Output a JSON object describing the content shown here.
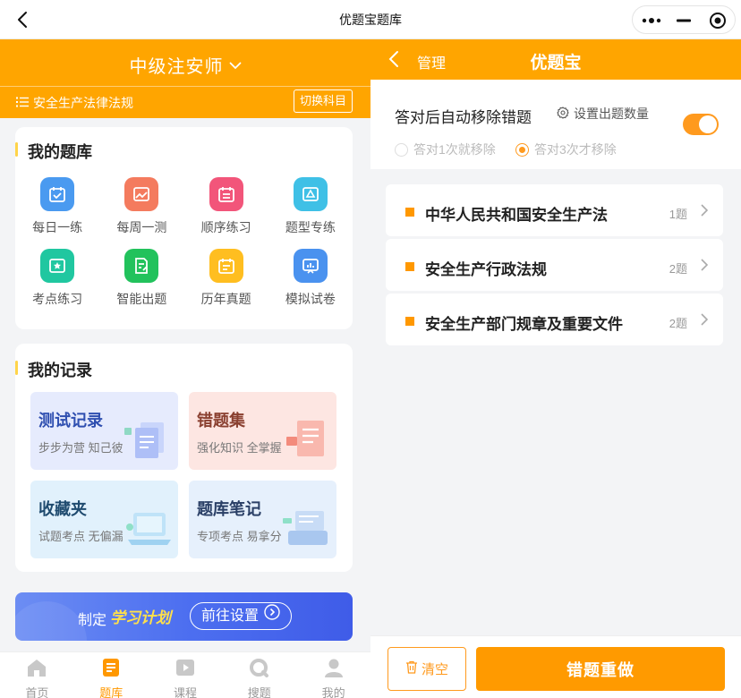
{
  "app": {
    "window_title": "优题宝题库"
  },
  "left": {
    "exam_name": "中级注安师",
    "subject": "安全生产法律法规",
    "switch_label": "切换科目",
    "library": {
      "title": "我的题库",
      "tiles": [
        {
          "label": "每日一练",
          "icon": "calendar-check-icon",
          "color": "#4a9af0"
        },
        {
          "label": "每周一测",
          "icon": "image-chart-icon",
          "color": "#f47b5e"
        },
        {
          "label": "顺序练习",
          "icon": "list-calendar-icon",
          "color": "#f2557a"
        },
        {
          "label": "题型专练",
          "icon": "triangle-board-icon",
          "color": "#3fc0e6"
        },
        {
          "label": "考点练习",
          "icon": "star-badge-icon",
          "color": "#20c7a0"
        },
        {
          "label": "智能出题",
          "icon": "doc-edit-icon",
          "color": "#22c25c"
        },
        {
          "label": "历年真题",
          "icon": "history-calendar-icon",
          "color": "#ffbe20"
        },
        {
          "label": "模拟试卷",
          "icon": "chart-board-icon",
          "color": "#4a92ef"
        }
      ]
    },
    "records": {
      "title": "我的记录",
      "items": [
        {
          "title": "测试记录",
          "subtitle": "步步为营 知己彼",
          "bg": "#e6ebfd",
          "color": "#2f4fb0"
        },
        {
          "title": "错题集",
          "subtitle": "强化知识 全掌握",
          "bg": "#fde6e2",
          "color": "#8a4030"
        },
        {
          "title": "收藏夹",
          "subtitle": "试题考点 无偏漏",
          "bg": "#e1f1fc",
          "color": "#1f4b6f"
        },
        {
          "title": "题库笔记",
          "subtitle": "专项考点 易拿分",
          "bg": "#e6f0fc",
          "color": "#2a3f66"
        }
      ]
    },
    "plan": {
      "prefix": "制定",
      "highlight": "学习计划",
      "button": "前往设置"
    },
    "tabs": [
      {
        "label": "首页",
        "icon": "home-icon"
      },
      {
        "label": "题库",
        "icon": "question-bank-icon"
      },
      {
        "label": "课程",
        "icon": "video-course-icon"
      },
      {
        "label": "搜题",
        "icon": "search-question-icon"
      },
      {
        "label": "我的",
        "icon": "user-icon"
      }
    ],
    "active_tab": 1
  },
  "right": {
    "back_label": "管理",
    "title": "优题宝",
    "auto_remove_label": "答对后自动移除错题",
    "auto_remove_on": true,
    "set_count_label": "设置出题数量",
    "remove_options": [
      {
        "label": "答对1次就移除",
        "selected": false
      },
      {
        "label": "答对3次才移除",
        "selected": true
      }
    ],
    "chapters": [
      {
        "name": "中华人民共和国安全生产法",
        "count": "1题"
      },
      {
        "name": "安全生产行政法规",
        "count": "2题"
      },
      {
        "name": "安全生产部门规章及重要文件",
        "count": "2题"
      }
    ],
    "clear_label": "清空",
    "redo_label": "错题重做"
  },
  "colors": {
    "brand": "#ffa500",
    "accent": "#ff9a00",
    "plan_blue": "#4d6ff0"
  }
}
